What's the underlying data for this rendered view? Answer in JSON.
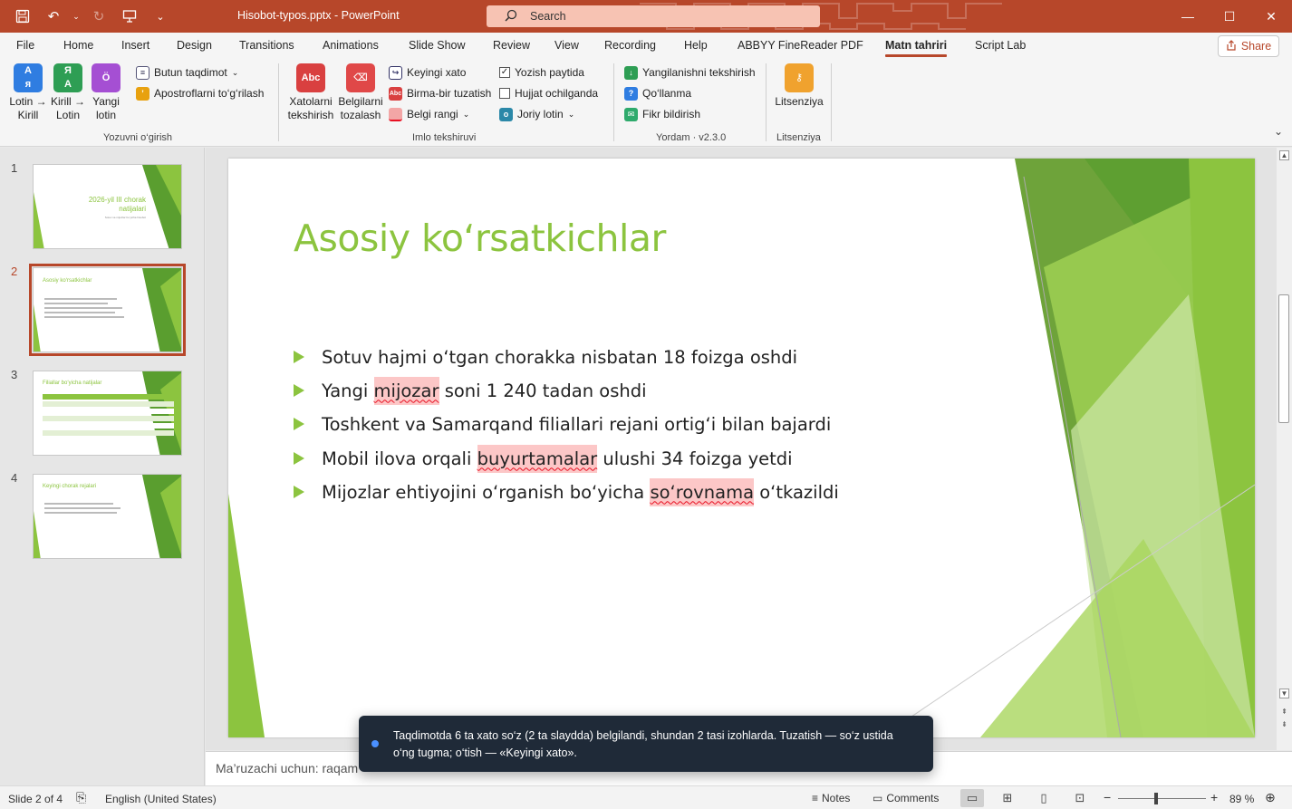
{
  "titlebar": {
    "document_title": "Hisobot-typos.pptx  -  PowerPoint",
    "search_placeholder": "Search",
    "qat_icons": [
      "save-icon",
      "undo-icon",
      "redo-icon",
      "present-icon",
      "customize-icon"
    ]
  },
  "tabs": [
    "File",
    "Home",
    "Insert",
    "Design",
    "Transitions",
    "Animations",
    "Slide Show",
    "Review",
    "View",
    "Recording",
    "Help",
    "ABBYY FineReader PDF",
    "Matn tahriri",
    "Script Lab"
  ],
  "active_tab": "Matn tahriri",
  "share_label": "Share",
  "ribbon": {
    "groups": {
      "yozuv": {
        "label": "Yozuvni o‘girish",
        "lotin_kirill": [
          "Lotin →",
          "Kirill"
        ],
        "kirill_lotin": [
          "Kirill →",
          "Lotin"
        ],
        "yangi_lotin": [
          "Yangi",
          "lotin"
        ],
        "butun_taqdimot": "Butun taqdimot",
        "apostroflar": "Apostroflarni to‘g‘rilash"
      },
      "imlo": {
        "label": "Imlo tekshiruvi",
        "xatolarni": [
          "Xatolarni",
          "tekshirish"
        ],
        "belgilarni": [
          "Belgilarni",
          "tozalash"
        ],
        "keyingi_xato": "Keyingi xato",
        "birma_bir": "Birma-bir tuzatish",
        "belgi_rangi": "Belgi rangi",
        "yozish_paytida": "Yozish paytida",
        "yozish_paytida_checked": true,
        "hujjat_ochilganda": "Hujjat ochilganda",
        "hujjat_ochilganda_checked": false,
        "joriy_lotin": "Joriy lotin"
      },
      "yordam": {
        "label": "Yordam · v2.3.0",
        "yangilanish": "Yangilanishni tekshirish",
        "qollanma": "Qo‘llanma",
        "fikr": "Fikr bildirish"
      },
      "litsenziya": {
        "label": "Litsenziya",
        "button": "Litsenziya"
      }
    }
  },
  "thumbnails": [
    {
      "number": "1",
      "title": "2026-yil III chorak natijalari",
      "subtitle": "Sotuv va mijozlar bo‘yicha hisobot"
    },
    {
      "number": "2",
      "title": "Asosiy ko‘rsatkichlar",
      "active": true
    },
    {
      "number": "3",
      "title": "Filiallar bo‘yicha natijalar"
    },
    {
      "number": "4",
      "title": "Keyingi chorak rejalari"
    }
  ],
  "slide": {
    "title": "Asosiy ko‘rsatkichlar",
    "bullets": [
      {
        "pre": "Sotuv hajmi o‘tgan chorakka nisbatan 18 foizga oshdi",
        "typo": "",
        "post": ""
      },
      {
        "pre": "Yangi ",
        "typo": "mijozar",
        "post": " soni 1 240 tadan oshdi"
      },
      {
        "pre": "Toshkent va Samarqand filiallari rejani ortig‘i bilan bajardi",
        "typo": "",
        "post": ""
      },
      {
        "pre": "Mobil ilova orqali ",
        "typo": "buyurtamalar",
        "post": " ulushi 34 foizga yetdi"
      },
      {
        "pre": "Mijozlar ehtiyojini o‘rganish bo‘yicha ",
        "typo": "so‘rovnama",
        "post": " o‘tkazildi"
      }
    ]
  },
  "notes_text": "Ma’ruzachi uchun: raqam",
  "toast": {
    "message": "Taqdimotda 6 ta xato so‘z (2 ta slaydda) belgilandi, shundan 2 tasi izohlarda. Tuzatish — so‘z ustida o‘ng tugma; o‘tish — «Keyingi xato»."
  },
  "statusbar": {
    "slide_counter": "Slide 2 of 4",
    "language": "English (United States)",
    "notes": "Notes",
    "comments": "Comments",
    "zoom": "89 %"
  },
  "colors": {
    "accent": "#b7472a",
    "slide_green": "#8cc43f",
    "typo_highlight": "#fcc7c7",
    "toast_bg": "#1f2a38"
  }
}
